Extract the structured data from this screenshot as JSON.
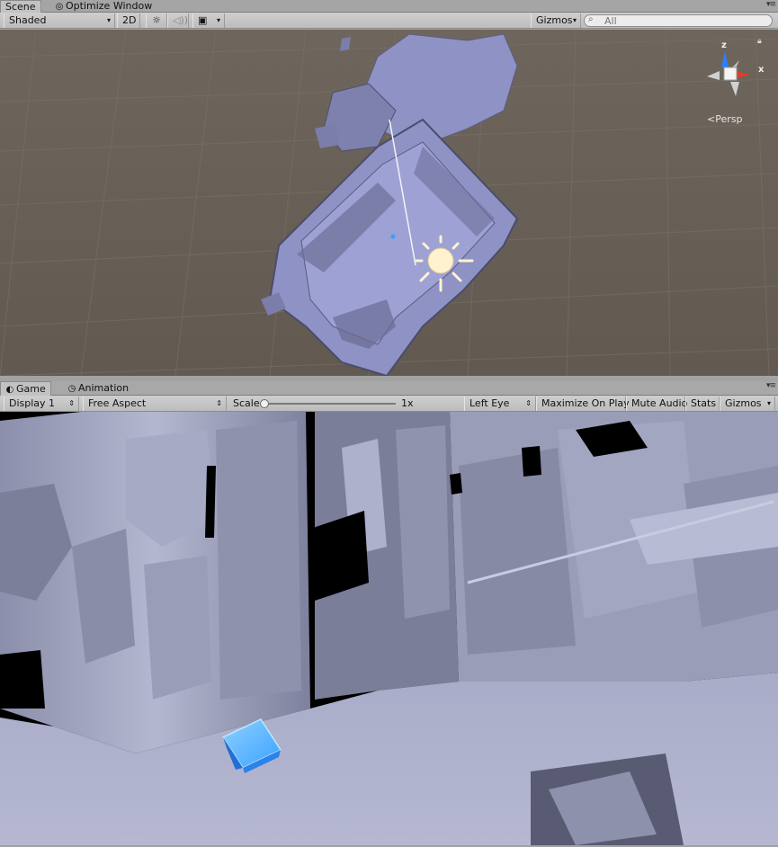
{
  "scene_tabs": {
    "scene": "Scene",
    "optimize": "Optimize Window"
  },
  "scene_toolbar": {
    "shading": "Shaded",
    "mode_2d": "2D",
    "gizmos": "Gizmos",
    "search_placeholder": "All"
  },
  "scene_gizmo": {
    "axis_z": "z",
    "axis_x": "x",
    "projection": "Persp"
  },
  "game_tabs": {
    "game": "Game",
    "animation": "Animation"
  },
  "game_toolbar": {
    "display": "Display 1",
    "aspect": "Free Aspect",
    "scale_label": "Scale",
    "scale_value": "1x",
    "eye": "Left Eye",
    "maximize": "Maximize On Play",
    "mute": "Mute Audio",
    "stats": "Stats",
    "gizmos": "Gizmos"
  },
  "colors": {
    "scene_bg": "#6b6359",
    "mesh": "#8f92c4",
    "cube": "#2f8fff",
    "game_mesh": "#9a9db8"
  }
}
